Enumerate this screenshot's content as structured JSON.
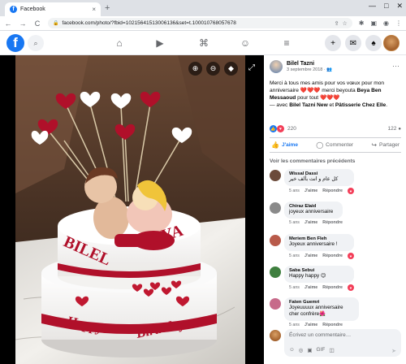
{
  "browser": {
    "tab_title": "Facebook",
    "tab_close": "×",
    "new_tab": "+",
    "window_controls": [
      "—",
      "□",
      "✕"
    ],
    "back": "←",
    "forward": "→",
    "reload": "C",
    "url": "facebook.com/photo/?fbid=10215641513006136&set=t.100010768057678",
    "url_actions": [
      "⇪",
      "☆"
    ],
    "extensions": [
      "✱",
      "▣",
      "◉",
      "⋮"
    ]
  },
  "fb_header": {
    "logo": "f",
    "search_icon": "⌕",
    "nav_icons": [
      "⌂",
      "▶",
      "⌘",
      "☺",
      "≡"
    ],
    "right_icons": [
      "+",
      "✉",
      "♠"
    ],
    "brand_color": "#1877f2"
  },
  "viewer": {
    "zoom_in": "⊕",
    "zoom_out": "⊖",
    "tag": "◆",
    "fullscreen": "⤢",
    "cake_text": {
      "left_name": "BILEL",
      "ampersand": "&",
      "right_name": "BEYA",
      "happy": "Happy",
      "birthday": "Birthday"
    }
  },
  "post": {
    "author": "Bilel Tazni",
    "date": "3 septembre 2018 · ",
    "privacy_icon": "👥",
    "more": "···",
    "caption_part1": "Merci à tous mes amis pour vos vœux pour mon anniversaire ",
    "hearts1": "❤️❤️❤️",
    "caption_part2": " merci beyouta ",
    "tagged1": "Beya Ben Messaoud",
    "caption_part3": " pour tout ",
    "hearts2": "❤️❤️❤️",
    "with_prefix": "— avec ",
    "tagged2": "Bilel Tazni New",
    "and": " et ",
    "tagged3": "Pâtisserie Chez Elle",
    "period": ".",
    "reaction_count": "220",
    "comment_count": "122",
    "like_label": "J'aime",
    "comment_label": "Commenter",
    "share_label": "Partager",
    "previous_comments": "Voir les commentaires précédents"
  },
  "comments": [
    {
      "name": "Wissal Dassi",
      "text": "كل عام و انت بألف خير",
      "age": "5 ans",
      "like": "J'aime",
      "reply": "Répondre",
      "avatar_color": "#6b4a3a"
    },
    {
      "name": "Chiraz Elaid",
      "text": "joyeux anniversaire",
      "age": "5 ans",
      "like": "J'aime",
      "reply": "Répondre",
      "avatar_color": "#8a8a8a"
    },
    {
      "name": "Meriem Ben Fleh",
      "text": "Joyeux anniversaire !",
      "age": "5 ans",
      "like": "J'aime",
      "reply": "Répondre",
      "avatar_color": "#b85a4a"
    },
    {
      "name": "Saba Sebui",
      "text": "Happy happy 😉",
      "age": "5 ans",
      "like": "J'aime",
      "reply": "Répondre",
      "avatar_color": "#3f7f3f"
    },
    {
      "name": "Faten Guemri",
      "text": "Joyeuuuux anniversaire cher confrère🌺",
      "age": "5 ans",
      "like": "J'aime",
      "reply": "Répondre",
      "avatar_color": "#c76a8a"
    }
  ],
  "composer": {
    "placeholder": "Écrivez un commentaire…",
    "icons": [
      "☺",
      "◎",
      "▣",
      "GIF",
      "◫"
    ],
    "send": "➤"
  }
}
